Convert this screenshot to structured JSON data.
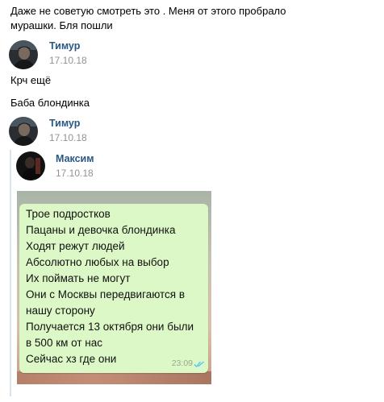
{
  "messages_top": {
    "lines": [
      "Даже не советую смотреть это . Меня от этого пробрало",
      "мурашки. Бля пошли"
    ]
  },
  "msg1": {
    "author": "Тимур",
    "date": "17.10.18",
    "lines": [
      "Крч ещё",
      "Баба блондинка"
    ]
  },
  "msg2": {
    "author": "Тимур",
    "date": "17.10.18"
  },
  "forwarded": {
    "author": "Максим",
    "date": "17.10.18",
    "screenshot": {
      "lines": [
        "Трое подростков",
        "Пацаны и девочка блондинка",
        "Ходят режут людей",
        "Абсолютно любых на выбор",
        "Их поймать не могут",
        "Они с Москвы передвигаются в",
        "нашу сторону",
        "Получается 13 октября они были",
        "в 500 км от нас",
        "Сейчас хз где они"
      ],
      "time": "23:09",
      "read_icon": "double-check-icon"
    }
  },
  "colors": {
    "author": "#2a5885",
    "date": "#939393",
    "bubble": "#dcf8c6",
    "forward_bar": "#dae2ea",
    "ticks": "#4fc3f7"
  }
}
